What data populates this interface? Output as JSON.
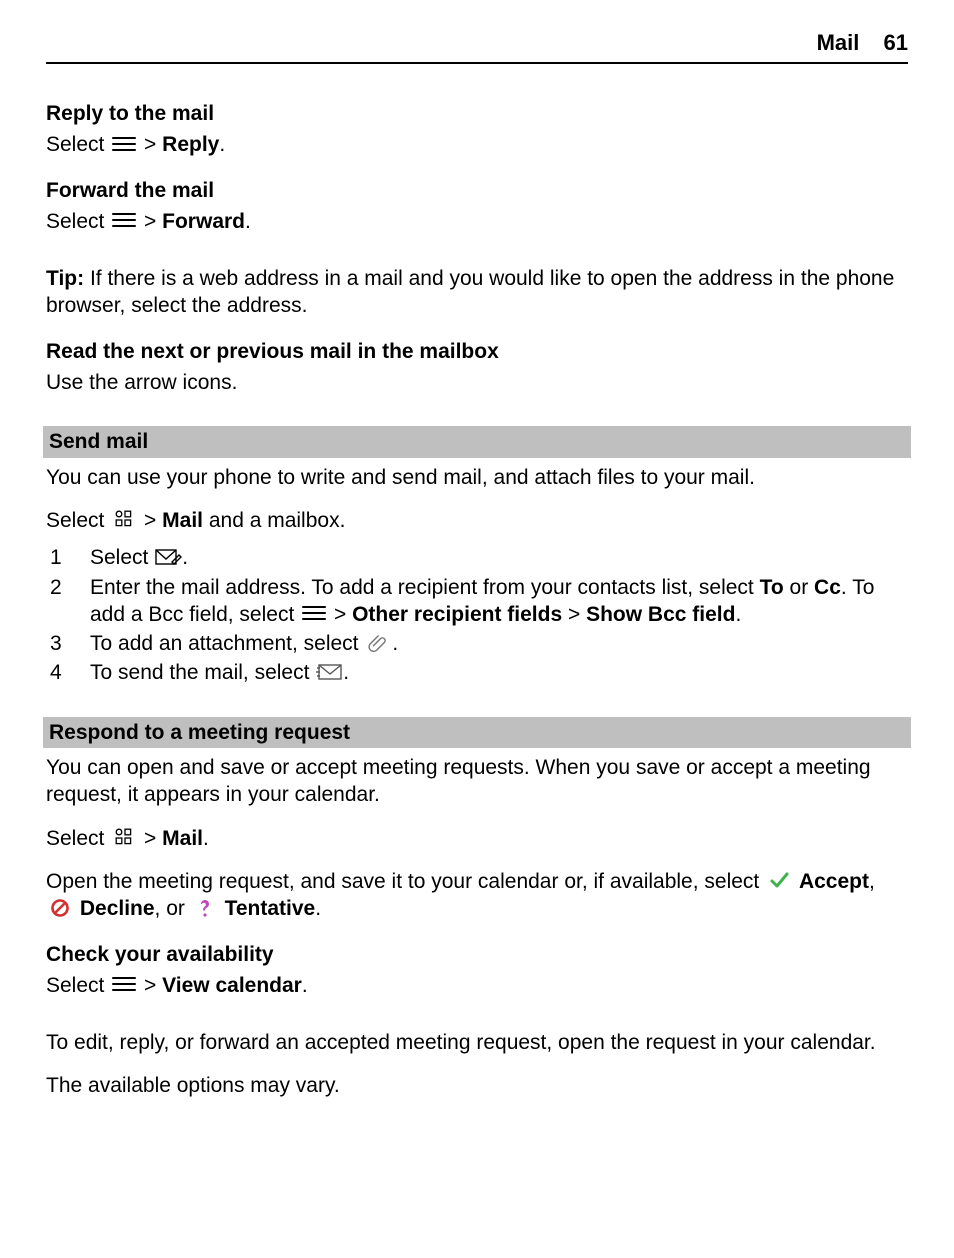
{
  "header": {
    "section": "Mail",
    "page_number": "61"
  },
  "reply": {
    "title": "Reply to the mail",
    "select": "Select ",
    "arrow": " > ",
    "action": "Reply",
    "period": "."
  },
  "forward": {
    "title": "Forward the mail",
    "select": "Select ",
    "arrow": " > ",
    "action": "Forward",
    "period": "."
  },
  "tip": {
    "label": "Tip:",
    "text": " If there is a web address in a mail and you would like to open the address in the phone browser, select the address."
  },
  "readnav": {
    "title": "Read the next or previous mail in the mailbox",
    "text": "Use the arrow icons."
  },
  "sendmail": {
    "title": "Send mail",
    "intro": "You can use your phone to write and send mail, and attach files to your mail.",
    "select": "Select ",
    "arrow": " > ",
    "mail": "Mail",
    "andmailbox": " and a mailbox.",
    "step1_pre": "Select ",
    "step1_post": ".",
    "step2_a": "Enter the mail address. To add a recipient from your contacts list, select ",
    "step2_to": "To",
    "step2_or": " or ",
    "step2_cc": "Cc",
    "step2_b": ". To add a Bcc field, select ",
    "step2_arrow1": " > ",
    "step2_other": "Other recipient fields",
    "step2_arrow2": "  > ",
    "step2_showbcc": "Show Bcc field",
    "step2_period": ".",
    "step3_a": "To add an attachment, select ",
    "step3_period": ".",
    "step4_a": "To send the mail, select ",
    "step4_period": "."
  },
  "meeting": {
    "title": "Respond to a meeting request",
    "intro": "You can open and save or accept meeting requests. When you save or accept a meeting request, it appears in your calendar.",
    "select": "Select ",
    "arrow": " > ",
    "mail": "Mail",
    "period": ".",
    "open_a": "Open the meeting request, and save it to your calendar or, if available, select ",
    "accept": "Accept",
    "comma1": ", ",
    "decline": "Decline",
    "or": ", or ",
    "tentative": "Tentative",
    "period2": "."
  },
  "availability": {
    "title": "Check your availability",
    "select": "Select ",
    "arrow": " > ",
    "view": "View calendar",
    "period": "."
  },
  "editnote": "To edit, reply, or forward an accepted meeting request, open the request in your calendar.",
  "optionsnote": "The available options may vary."
}
